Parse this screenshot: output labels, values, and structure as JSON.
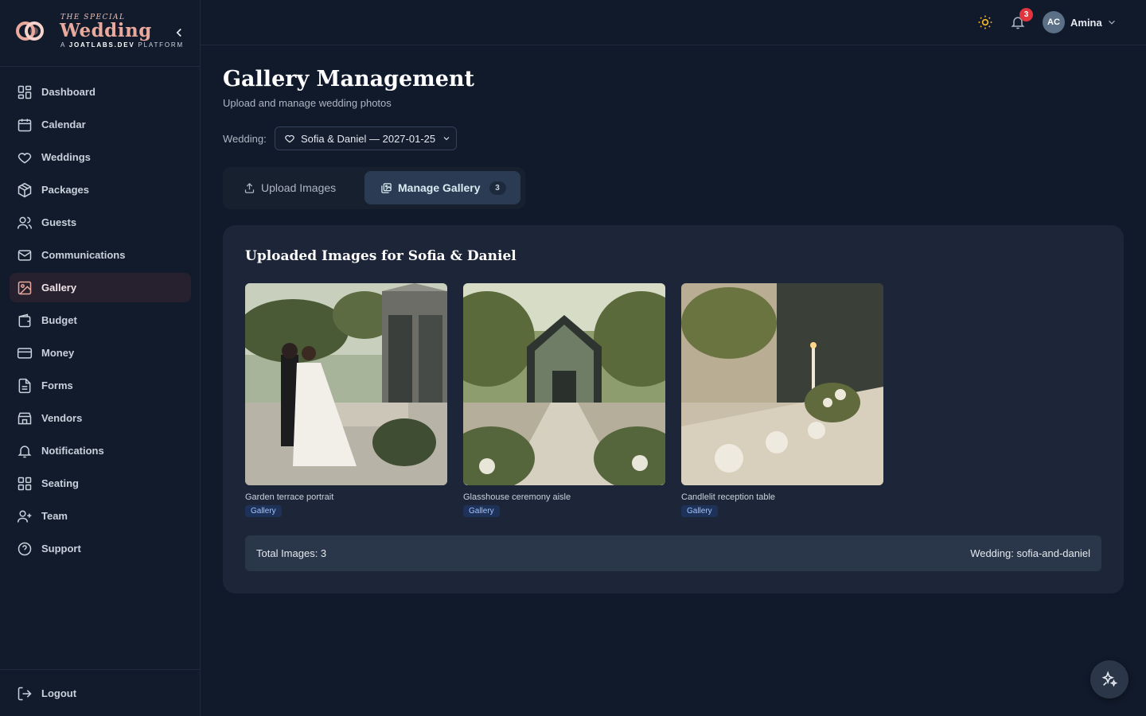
{
  "brand": {
    "tagline_top": "THE SPECIAL",
    "name": "Wedding",
    "tagline_prefix": "A ",
    "tagline_domain": "JOATLABS.DEV",
    "tagline_suffix": " PLATFORM"
  },
  "sidebar": {
    "items": [
      {
        "label": "Dashboard",
        "icon": "grid-icon"
      },
      {
        "label": "Calendar",
        "icon": "calendar-icon"
      },
      {
        "label": "Weddings",
        "icon": "heart-icon"
      },
      {
        "label": "Packages",
        "icon": "package-icon"
      },
      {
        "label": "Guests",
        "icon": "users-icon"
      },
      {
        "label": "Communications",
        "icon": "mail-icon"
      },
      {
        "label": "Gallery",
        "icon": "image-icon",
        "active": true
      },
      {
        "label": "Budget",
        "icon": "wallet-icon"
      },
      {
        "label": "Money",
        "icon": "card-icon"
      },
      {
        "label": "Forms",
        "icon": "file-icon"
      },
      {
        "label": "Vendors",
        "icon": "store-icon"
      },
      {
        "label": "Notifications",
        "icon": "bell-icon"
      },
      {
        "label": "Seating",
        "icon": "grid-icon"
      },
      {
        "label": "Team",
        "icon": "user-plus-icon"
      },
      {
        "label": "Support",
        "icon": "help-icon"
      }
    ],
    "logout_label": "Logout"
  },
  "topbar": {
    "notification_count": "3",
    "avatar_initials": "AC",
    "user_name": "Amina"
  },
  "page": {
    "title": "Gallery Management",
    "subtitle": "Upload and manage wedding photos",
    "wedding_label": "Wedding:",
    "wedding_selected": "Sofia & Daniel — 2027-01-25"
  },
  "tabs": {
    "upload_label": "Upload Images",
    "manage_label": "Manage Gallery",
    "manage_count": "3"
  },
  "gallery": {
    "title": "Uploaded Images for Sofia & Daniel",
    "images": [
      {
        "caption": "Garden terrace portrait",
        "tag": "Gallery"
      },
      {
        "caption": "Glasshouse ceremony aisle",
        "tag": "Gallery"
      },
      {
        "caption": "Candlelit reception table",
        "tag": "Gallery"
      }
    ],
    "total_label": "Total Images: 3",
    "wedding_slug_label": "Wedding: sofia-and-daniel"
  },
  "colors": {
    "accent": "#e9a99c",
    "active_tab": "#2a3b53",
    "badge": "#e0353f",
    "tag_bg": "#1e3158"
  }
}
